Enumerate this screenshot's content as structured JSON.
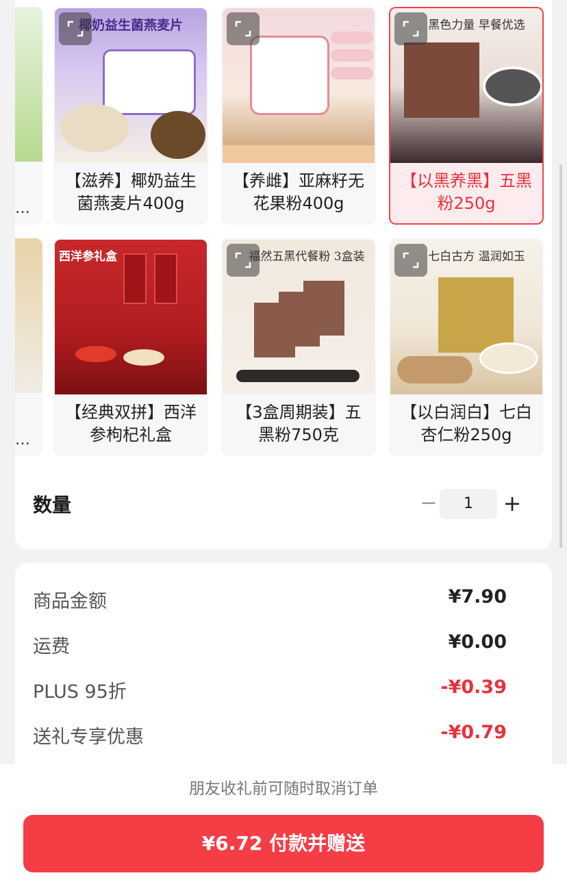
{
  "products_row1": [
    {
      "label": "【滋养】椰奶益生菌燕麦片400g",
      "banner": "椰奶益生菌燕麦片",
      "selected": false
    },
    {
      "label": "【养雌】亚麻籽无花果粉400g",
      "banner": "",
      "selected": false
    },
    {
      "label": "【以黑养黑】五黑粉250g",
      "banner": "黑色力量 早餐优选",
      "selected": true
    }
  ],
  "products_row2": [
    {
      "label": "【经典双拼】西洋参枸杞礼盒",
      "banner": "西洋参礼盒",
      "selected": false
    },
    {
      "label": "【3盒周期装】五黑粉750克",
      "banner": "福然五黑代餐粉 3盒装",
      "selected": false
    },
    {
      "label": "【以白润白】七白杏仁粉250g",
      "banner": "七白古方 温润如玉",
      "selected": false
    }
  ],
  "partial_items": {
    "dots": "…"
  },
  "quantity": {
    "label": "数量",
    "minus": "−",
    "value": "1",
    "plus": "+"
  },
  "summary": {
    "rows": [
      {
        "key": "商品金额",
        "value": "¥7.90",
        "red": false
      },
      {
        "key": "运费",
        "value": "¥0.00",
        "red": false
      },
      {
        "key": "PLUS 95折",
        "value": "-¥0.39",
        "red": true
      },
      {
        "key": "送礼专享优惠",
        "value": "-¥0.79",
        "red": true
      }
    ]
  },
  "footer": {
    "notice": "朋友收礼前可随时取消订单",
    "pay_button": "¥6.72 付款并赠送"
  },
  "colors": {
    "accent": "#f53d46",
    "discount": "#e8323c"
  }
}
